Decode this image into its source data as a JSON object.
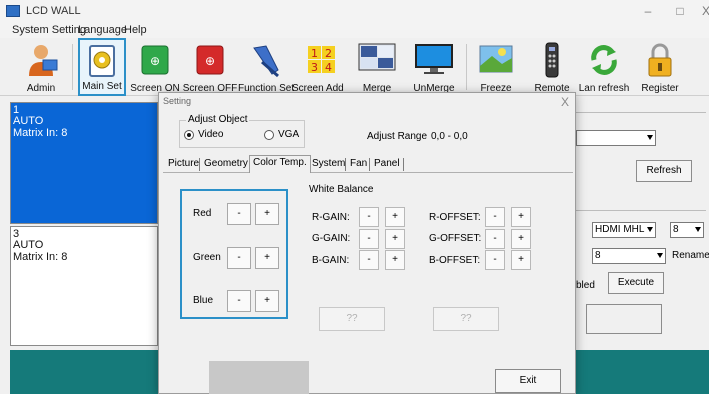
{
  "window": {
    "title": "LCD WALL",
    "minimize": "–",
    "maximize": "□",
    "close": "X"
  },
  "menu": {
    "system": "System Setting",
    "language": "Language",
    "help": "Help"
  },
  "toolbar": {
    "admin": "Admin",
    "main_set": "Main Set",
    "screen_on": "Screen ON",
    "screen_off": "Screen OFF",
    "function_set": "Function Set",
    "screen_addr": "Screen Addr",
    "merge": "Merge",
    "unmerge": "UnMerge",
    "freeze": "Freeze",
    "remote": "Remote",
    "lan_refresh": "Lan refresh",
    "register": "Register",
    "addr_digits": [
      "1",
      "2",
      "3",
      "4"
    ]
  },
  "panels": [
    {
      "num": "1",
      "mode": "AUTO",
      "matrix": "Matrix In: 8"
    },
    {
      "num": "3",
      "mode": "AUTO",
      "matrix": "Matrix In: 8"
    }
  ],
  "background": {
    "refresh": "Refresh",
    "input_select": "HDMI MHL",
    "input_num": "8",
    "second_select": "8",
    "rename": "Rename",
    "enabled_tail": "bled",
    "execute": "Execute"
  },
  "dialog": {
    "title": "Setting",
    "close": "X",
    "adjust_object": "Adjust Object",
    "video": "Video",
    "vga": "VGA",
    "adjust_range_label": "Adjust Range",
    "adjust_range_value": "0,0 - 0,0",
    "tabs": [
      "Picture",
      "Geometry",
      "Color Temp.",
      "System",
      "Fan",
      "Panel"
    ],
    "white_balance": "White Balance",
    "colors": [
      "Red",
      "Green",
      "Blue"
    ],
    "gains": [
      "R-GAIN:",
      "G-GAIN:",
      "B-GAIN:"
    ],
    "offsets": [
      "R-OFFSET:",
      "G-OFFSET:",
      "B-OFFSET:"
    ],
    "minus": "-",
    "plus": "+",
    "placeholder_btn": "??",
    "exit": "Exit"
  },
  "colors": {
    "accent_blue": "#2b90c8",
    "selected_panel": "#0a66d6",
    "teal": "#157a7a"
  }
}
